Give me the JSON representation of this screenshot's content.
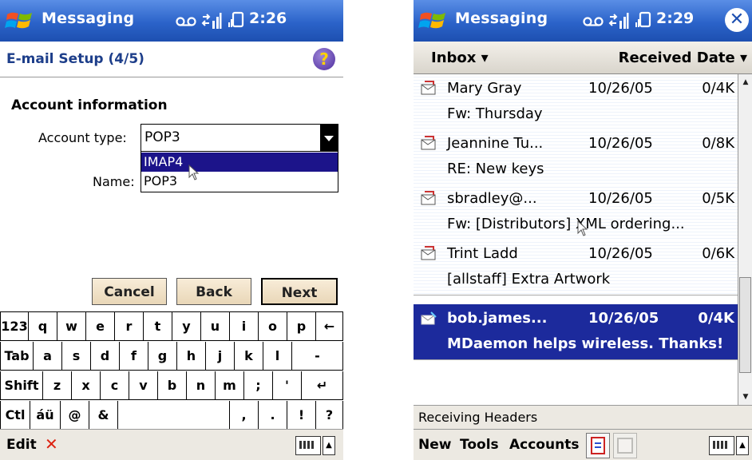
{
  "left": {
    "app_title": "Messaging",
    "status_time": "2:26",
    "setup_title": "E-mail Setup (4/5)",
    "help_glyph": "?",
    "section_title": "Account information",
    "account_type_label": "Account type:",
    "account_type_value": "POP3",
    "name_label": "Name:",
    "dropdown_options": [
      "IMAP4",
      "POP3"
    ],
    "dropdown_selected": "IMAP4",
    "buttons": {
      "cancel": "Cancel",
      "back": "Back",
      "next": "Next"
    },
    "keyboard": {
      "row1": [
        "123",
        "q",
        "w",
        "e",
        "r",
        "t",
        "y",
        "u",
        "i",
        "o",
        "p",
        "←"
      ],
      "row2": [
        "Tab",
        "a",
        "s",
        "d",
        "f",
        "g",
        "h",
        "j",
        "k",
        "l",
        "-"
      ],
      "row3": [
        "Shift",
        "z",
        "x",
        "c",
        "v",
        "b",
        "n",
        "m",
        ";",
        "'",
        "↵"
      ],
      "row4": [
        "Ctl",
        "áü",
        "@",
        "&",
        "",
        ",",
        ".",
        "!",
        "?"
      ]
    },
    "menu_edit": "Edit",
    "delete_glyph": "✕",
    "icons": [
      "windows-logo-icon",
      "voicemail-icon",
      "connectivity-icon",
      "signal-icon",
      "help-icon",
      "keyboard-icon",
      "arrow-up-icon"
    ]
  },
  "right": {
    "app_title": "Messaging",
    "status_time": "2:29",
    "close_glyph": "✕",
    "folder": "Inbox ▾",
    "sort": "Received Date ▾",
    "messages": [
      {
        "from": "Mary Gray",
        "date": "10/26/05",
        "size": "0/4K",
        "subject": "Fw: Thursday",
        "selected": false
      },
      {
        "from": "Jeannine Tu...",
        "date": "10/26/05",
        "size": "0/8K",
        "subject": "RE: New keys",
        "selected": false
      },
      {
        "from": "sbradley@...",
        "date": "10/26/05",
        "size": "0/5K",
        "subject": "Fw: [Distributors] XML ordering...",
        "selected": false
      },
      {
        "from": "Trint Ladd",
        "date": "10/26/05",
        "size": "0/6K",
        "subject": "[allstaff] Extra Artwork",
        "selected": false
      },
      {
        "from": "bob.james...",
        "date": "10/26/05",
        "size": "0/4K",
        "subject": "MDaemon helps wireless. Thanks!",
        "selected": true
      }
    ],
    "status": "Receiving Headers",
    "menu": {
      "new": "New",
      "tools": "Tools",
      "accounts": "Accounts"
    },
    "colors": {
      "titlebar": "#2b63c9",
      "selection": "#1c2a9c",
      "dropdown_selection": "#1c148a"
    }
  }
}
